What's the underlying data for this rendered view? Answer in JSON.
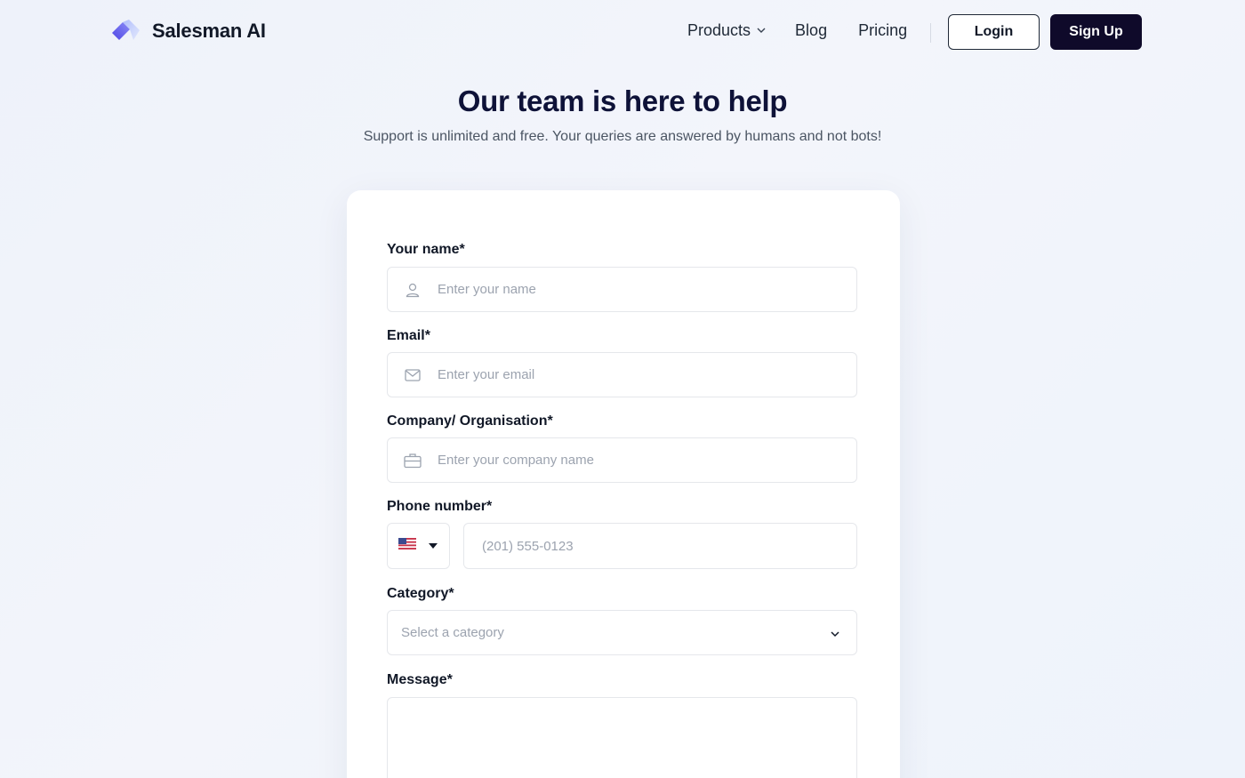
{
  "brand": {
    "name": "Salesman AI",
    "logo_icon": "salesman-logo-icon"
  },
  "nav": {
    "products": "Products",
    "blog": "Blog",
    "pricing": "Pricing",
    "login": "Login",
    "signup": "Sign Up"
  },
  "hero": {
    "title": "Our team is here to help",
    "subtitle": "Support is unlimited and free. Your queries are answered by humans and not bots!"
  },
  "form": {
    "name": {
      "label": "Your name*",
      "placeholder": "Enter your name",
      "icon": "user-icon"
    },
    "email": {
      "label": "Email*",
      "placeholder": "Enter your email",
      "icon": "mail-icon"
    },
    "company": {
      "label": "Company/ Organisation*",
      "placeholder": "Enter your company name",
      "icon": "briefcase-icon"
    },
    "phone": {
      "label": "Phone number*",
      "placeholder": "(201) 555-0123",
      "country_icon": "us-flag-icon"
    },
    "category": {
      "label": "Category*",
      "placeholder": "Select a category"
    },
    "message": {
      "label": "Message*",
      "placeholder": ""
    }
  },
  "colors": {
    "accent": "#6366f1",
    "primary_dark": "#0f0a2a",
    "title": "#0e1238"
  }
}
